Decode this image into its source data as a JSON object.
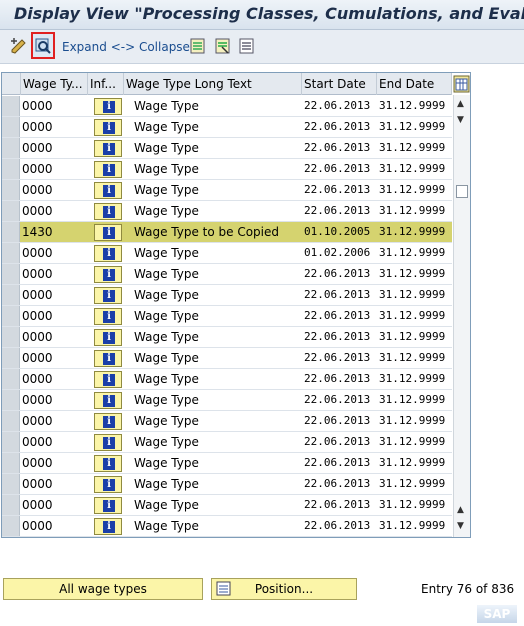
{
  "window": {
    "title": "Display View \"Processing Classes, Cumulations, and Evalua"
  },
  "toolbar": {
    "expand_collapse": "Expand <-> Collapse"
  },
  "table": {
    "columns": [
      "Wage Ty...",
      "Inf...",
      "Wage Type Long Text",
      "Start Date",
      "End Date"
    ],
    "rows": [
      {
        "code": "0000",
        "text": "Wage Type",
        "start": "22.06.2013",
        "end": "31.12.9999"
      },
      {
        "code": "0000",
        "text": "Wage Type",
        "start": "22.06.2013",
        "end": "31.12.9999"
      },
      {
        "code": "0000",
        "text": "Wage Type",
        "start": "22.06.2013",
        "end": "31.12.9999"
      },
      {
        "code": "0000",
        "text": "Wage Type",
        "start": "22.06.2013",
        "end": "31.12.9999"
      },
      {
        "code": "0000",
        "text": "Wage Type",
        "start": "22.06.2013",
        "end": "31.12.9999"
      },
      {
        "code": "0000",
        "text": "Wage Type",
        "start": "22.06.2013",
        "end": "31.12.9999"
      },
      {
        "code": "1430",
        "text": "Wage Type to be Copied",
        "start": "01.10.2005",
        "end": "31.12.9999"
      },
      {
        "code": "0000",
        "text": "Wage Type",
        "start": "01.02.2006",
        "end": "31.12.9999"
      },
      {
        "code": "0000",
        "text": "Wage Type",
        "start": "22.06.2013",
        "end": "31.12.9999"
      },
      {
        "code": "0000",
        "text": "Wage Type",
        "start": "22.06.2013",
        "end": "31.12.9999"
      },
      {
        "code": "0000",
        "text": "Wage Type",
        "start": "22.06.2013",
        "end": "31.12.9999"
      },
      {
        "code": "0000",
        "text": "Wage Type",
        "start": "22.06.2013",
        "end": "31.12.9999"
      },
      {
        "code": "0000",
        "text": "Wage Type",
        "start": "22.06.2013",
        "end": "31.12.9999"
      },
      {
        "code": "0000",
        "text": "Wage Type",
        "start": "22.06.2013",
        "end": "31.12.9999"
      },
      {
        "code": "0000",
        "text": "Wage Type",
        "start": "22.06.2013",
        "end": "31.12.9999"
      },
      {
        "code": "0000",
        "text": "Wage Type",
        "start": "22.06.2013",
        "end": "31.12.9999"
      },
      {
        "code": "0000",
        "text": "Wage Type",
        "start": "22.06.2013",
        "end": "31.12.9999"
      },
      {
        "code": "0000",
        "text": "Wage Type",
        "start": "22.06.2013",
        "end": "31.12.9999"
      },
      {
        "code": "0000",
        "text": "Wage Type",
        "start": "22.06.2013",
        "end": "31.12.9999"
      },
      {
        "code": "0000",
        "text": "Wage Type",
        "start": "22.06.2013",
        "end": "31.12.9999"
      },
      {
        "code": "0000",
        "text": "Wage Type",
        "start": "22.06.2013",
        "end": "31.12.9999"
      }
    ],
    "highlight_row": 6,
    "info_icon": "info-icon",
    "highlight_color": "#d5d36f"
  },
  "bottom": {
    "all_wage_types": "All wage types",
    "position": "Position...",
    "entry": "Entry 76 of 836"
  },
  "footer": {
    "logo": "SAP"
  }
}
